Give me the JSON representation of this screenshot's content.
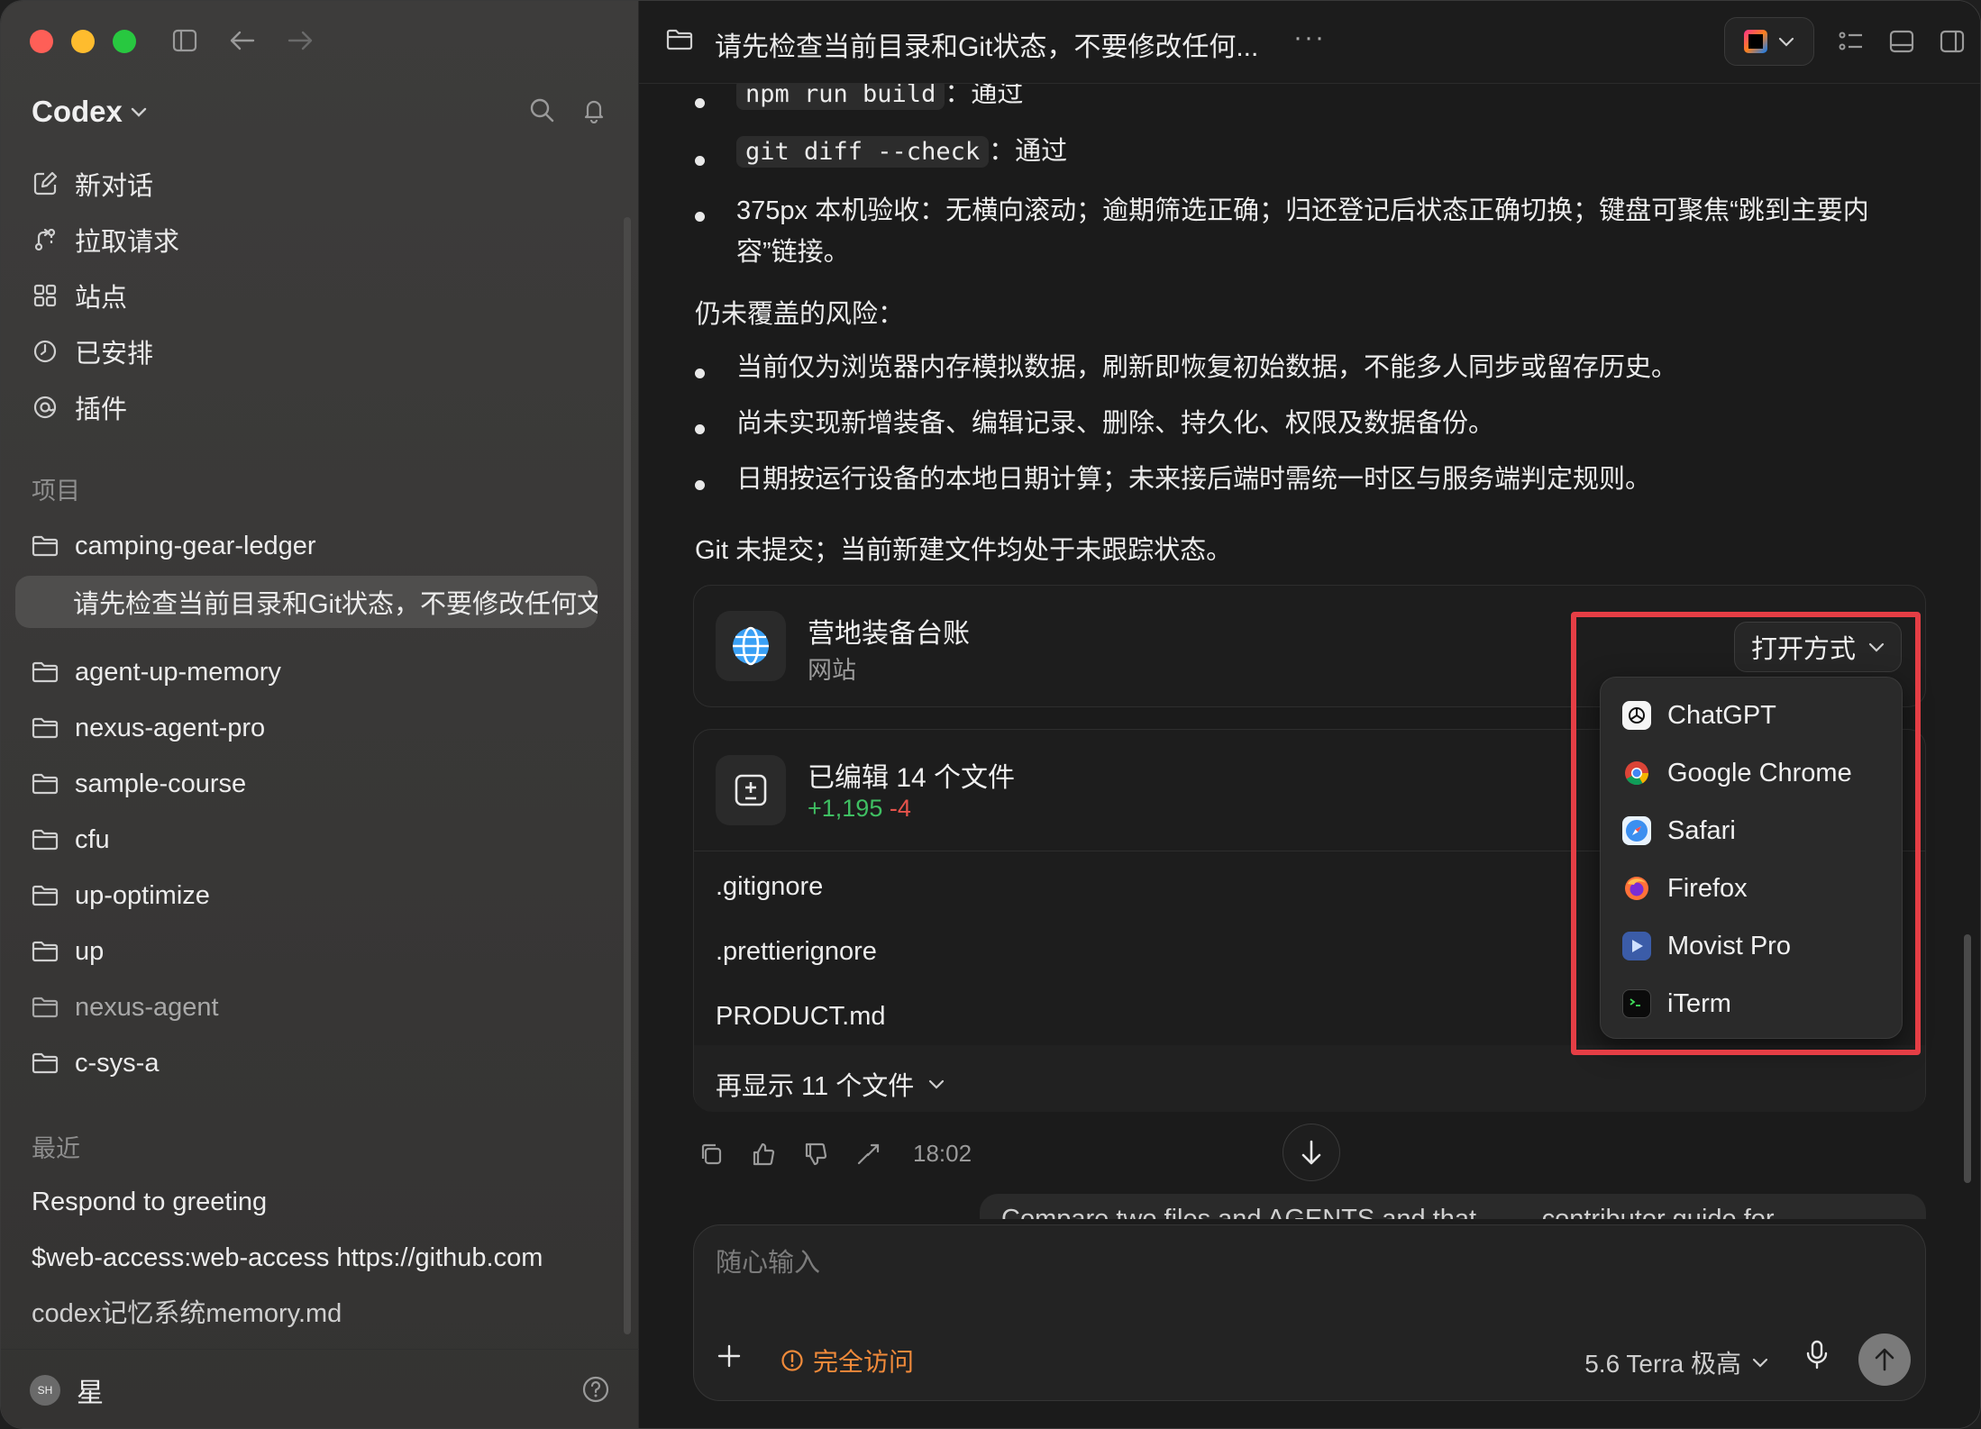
{
  "sidebar": {
    "brand": "Codex",
    "nav": [
      {
        "label": "新对话"
      },
      {
        "label": "拉取请求"
      },
      {
        "label": "站点"
      },
      {
        "label": "已安排"
      },
      {
        "label": "插件"
      }
    ],
    "projects_label": "项目",
    "projects": [
      {
        "label": "camping-gear-ledger"
      },
      {
        "label": "请先检查当前目录和Git状态，不要修改任何文件"
      },
      {
        "label": "agent-up-memory"
      },
      {
        "label": "nexus-agent-pro"
      },
      {
        "label": "sample-course"
      },
      {
        "label": "cfu"
      },
      {
        "label": "up-optimize"
      },
      {
        "label": "up"
      },
      {
        "label": "nexus-agent"
      },
      {
        "label": "c-sys-a"
      }
    ],
    "recent_label": "最近",
    "recents": [
      {
        "label": "Respond to greeting"
      },
      {
        "label": "$web-access:web-access https://github.com"
      },
      {
        "label": "codex记忆系统memory.md"
      }
    ],
    "user": {
      "initials": "SH",
      "name": "星"
    }
  },
  "header": {
    "title": "请先检查当前目录和Git状态，不要修改任何...",
    "more": "···"
  },
  "message": {
    "bullets_top": [
      {
        "code": "npm run build",
        "text": "：通过"
      },
      {
        "code": "git diff --check",
        "text": "：通过"
      }
    ],
    "bullet_375_line1": "375px 本机验收：无横向滚动；逾期筛选正确；归还登记后状态正确切换；键盘可聚焦“跳到主要内",
    "bullet_375_line2": "容”链接。",
    "risks_label": "仍未覆盖的风险：",
    "risks": [
      "当前仅为浏览器内存模拟数据，刷新即恢复初始数据，不能多人同步或留存历史。",
      "尚未实现新增装备、编辑记录、删除、持久化、权限及数据备份。",
      "日期按运行设备的本地日期计算；未来接后端时需统一时区与服务端判定规则。"
    ],
    "git_note": "Git 未提交；当前新建文件均处于未跟踪状态。"
  },
  "site_card": {
    "title": "营地装备台账",
    "subtitle": "网站",
    "open_button": "打开方式"
  },
  "files_card": {
    "title": "已编辑 14 个文件",
    "added": "+1,195",
    "removed": "-4",
    "files": [
      ".gitignore",
      ".prettierignore",
      "PRODUCT.md"
    ],
    "show_more": "再显示 11 个文件"
  },
  "message_meta": {
    "time": "18:02"
  },
  "ghost_message": "Compare two files and AGENTS and that ... ... contributor guide for",
  "composer": {
    "placeholder": "随心输入",
    "access_label": "完全访问",
    "model_label": "5.6 Terra 极高"
  },
  "open_with_menu": [
    {
      "label": "ChatGPT",
      "icon": "chatgpt-icon"
    },
    {
      "label": "Google Chrome",
      "icon": "chrome-icon"
    },
    {
      "label": "Safari",
      "icon": "safari-icon"
    },
    {
      "label": "Firefox",
      "icon": "firefox-icon"
    },
    {
      "label": "Movist Pro",
      "icon": "movist-icon"
    },
    {
      "label": "iTerm",
      "icon": "iterm-icon"
    }
  ],
  "colors": {
    "accent_highlight": "#e53e45",
    "diff_add": "#3fbf62",
    "diff_del": "#e5534b",
    "warning": "#f08a3a"
  }
}
